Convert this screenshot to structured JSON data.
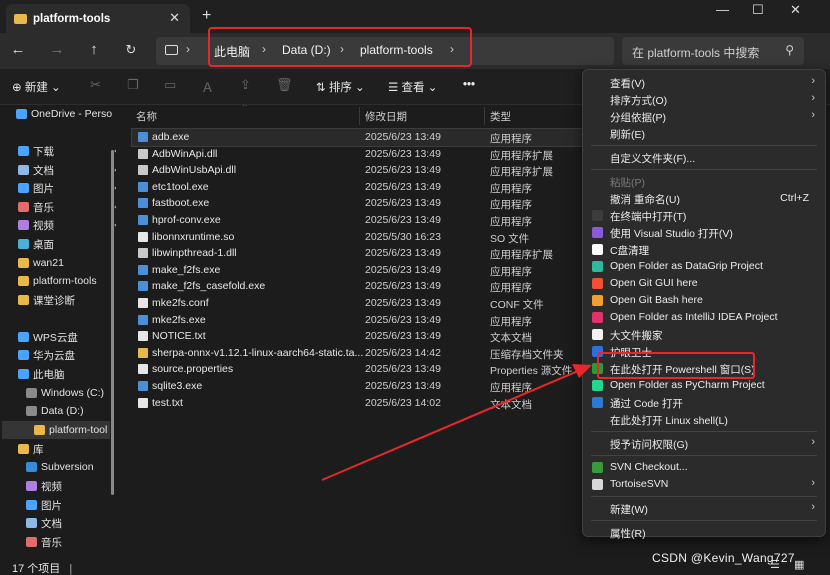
{
  "window": {
    "tab_title": "platform-tools",
    "new_tab_symbol": "+",
    "minimize_symbol": "—",
    "maximize_symbol": "☐",
    "close_symbol": "✕"
  },
  "nav": {
    "back": "←",
    "forward": "→",
    "up": "↑",
    "refresh": "↻"
  },
  "address": {
    "crumbs": [
      "此电脑",
      "Data (D:)",
      "platform-tools"
    ],
    "separator": "›"
  },
  "search": {
    "placeholder": "在 platform-tools 中搜索"
  },
  "toolbar": {
    "new_label": "新建",
    "sort_label": "排序",
    "view_label": "查看",
    "more_label": "•••"
  },
  "sidebar": {
    "items": [
      {
        "label": "OneDrive - Perso",
        "icon": "cloud-icon"
      },
      {
        "label": "下载",
        "icon": "download-icon"
      },
      {
        "label": "文档",
        "icon": "document-icon"
      },
      {
        "label": "图片",
        "icon": "pictures-icon"
      },
      {
        "label": "音乐",
        "icon": "music-icon"
      },
      {
        "label": "视频",
        "icon": "video-icon"
      },
      {
        "label": "桌面",
        "icon": "desktop-icon"
      },
      {
        "label": "wan21",
        "icon": "folder-icon"
      },
      {
        "label": "platform-tools",
        "icon": "folder-icon"
      },
      {
        "label": "课堂诊断",
        "icon": "folder-icon"
      },
      {
        "label": "WPS云盘",
        "icon": "cloud-icon"
      },
      {
        "label": "华为云盘",
        "icon": "cloud-icon"
      },
      {
        "label": "此电脑",
        "icon": "pc-icon"
      },
      {
        "label": "Windows (C:)",
        "icon": "drive-icon"
      },
      {
        "label": "Data (D:)",
        "icon": "drive-icon"
      },
      {
        "label": "platform-tool",
        "icon": "folder-icon"
      },
      {
        "label": "库",
        "icon": "library-icon"
      },
      {
        "label": "Subversion",
        "icon": "subversion-icon"
      },
      {
        "label": "视频",
        "icon": "video-icon"
      },
      {
        "label": "图片",
        "icon": "pictures-icon"
      },
      {
        "label": "文档",
        "icon": "document-icon"
      },
      {
        "label": "音乐",
        "icon": "music-icon"
      }
    ],
    "pin_symbol": "📌"
  },
  "columns": {
    "name": "名称",
    "date": "修改日期",
    "type": "类型"
  },
  "files": [
    {
      "name": "adb.exe",
      "date": "2025/6/23 13:49",
      "type": "应用程序",
      "icon": "exe"
    },
    {
      "name": "AdbWinApi.dll",
      "date": "2025/6/23 13:49",
      "type": "应用程序扩展",
      "icon": "dll"
    },
    {
      "name": "AdbWinUsbApi.dll",
      "date": "2025/6/23 13:49",
      "type": "应用程序扩展",
      "icon": "dll"
    },
    {
      "name": "etc1tool.exe",
      "date": "2025/6/23 13:49",
      "type": "应用程序",
      "icon": "exe"
    },
    {
      "name": "fastboot.exe",
      "date": "2025/6/23 13:49",
      "type": "应用程序",
      "icon": "exe"
    },
    {
      "name": "hprof-conv.exe",
      "date": "2025/6/23 13:49",
      "type": "应用程序",
      "icon": "exe"
    },
    {
      "name": "libonnxruntime.so",
      "date": "2025/5/30 16:23",
      "type": "SO 文件",
      "icon": "file"
    },
    {
      "name": "libwinpthread-1.dll",
      "date": "2025/6/23 13:49",
      "type": "应用程序扩展",
      "icon": "dll"
    },
    {
      "name": "make_f2fs.exe",
      "date": "2025/6/23 13:49",
      "type": "应用程序",
      "icon": "exe"
    },
    {
      "name": "make_f2fs_casefold.exe",
      "date": "2025/6/23 13:49",
      "type": "应用程序",
      "icon": "exe"
    },
    {
      "name": "mke2fs.conf",
      "date": "2025/6/23 13:49",
      "type": "CONF 文件",
      "icon": "file"
    },
    {
      "name": "mke2fs.exe",
      "date": "2025/6/23 13:49",
      "type": "应用程序",
      "icon": "exe"
    },
    {
      "name": "NOTICE.txt",
      "date": "2025/6/23 13:49",
      "type": "文本文档",
      "icon": "file"
    },
    {
      "name": "sherpa-onnx-v1.12.1-linux-aarch64-static.ta...",
      "date": "2025/6/23 14:42",
      "type": "压缩存档文件夹",
      "icon": "zip"
    },
    {
      "name": "source.properties",
      "date": "2025/6/23 13:49",
      "type": "Properties 源文件",
      "icon": "file"
    },
    {
      "name": "sqlite3.exe",
      "date": "2025/6/23 13:49",
      "type": "应用程序",
      "icon": "exe"
    },
    {
      "name": "test.txt",
      "date": "2025/6/23 14:02",
      "type": "文本文档",
      "icon": "file"
    }
  ],
  "status": {
    "item_count": "17 个项目"
  },
  "watermark": "CSDN @Kevin_Wang727",
  "context_menu": {
    "items": [
      {
        "label": "查看(V)",
        "arrow": "›",
        "icon": "none"
      },
      {
        "label": "排序方式(O)",
        "arrow": "›",
        "icon": "none"
      },
      {
        "label": "分组依据(P)",
        "arrow": "›",
        "icon": "none"
      },
      {
        "label": "刷新(E)",
        "icon": "none"
      },
      {
        "sep": true
      },
      {
        "label": "自定义文件夹(F)...",
        "icon": "none"
      },
      {
        "sep": true
      },
      {
        "label": "粘贴(P)",
        "dim": true,
        "icon": "none"
      },
      {
        "label": "撤消 重命名(U)",
        "shortcut": "Ctrl+Z",
        "icon": "none"
      },
      {
        "label": "在终端中打开(T)",
        "icon": "terminal-icon"
      },
      {
        "label": "使用 Visual Studio 打开(V)",
        "icon": "visual-studio-icon"
      },
      {
        "label": "C盘清理",
        "icon": "cleanup-icon"
      },
      {
        "label": "Open Folder as DataGrip Project",
        "icon": "datagrip-icon"
      },
      {
        "label": "Open Git GUI here",
        "icon": "git-gui-icon"
      },
      {
        "label": "Open Git Bash here",
        "icon": "git-bash-icon"
      },
      {
        "label": "Open Folder as IntelliJ IDEA Project",
        "icon": "intellij-icon"
      },
      {
        "label": "大文件搬家",
        "icon": "move-files-icon"
      },
      {
        "label": "护眼卫士",
        "icon": "shield-icon"
      },
      {
        "label": "在此处打开 Powershell 窗口(S)",
        "icon": "powershell-icon"
      },
      {
        "label": "Open Folder as PyCharm Project",
        "icon": "pycharm-icon"
      },
      {
        "label": "通过 Code 打开",
        "icon": "vscode-icon"
      },
      {
        "label": "在此处打开 Linux shell(L)",
        "icon": "none"
      },
      {
        "sep": true
      },
      {
        "label": "授予访问权限(G)",
        "arrow": "›",
        "icon": "none"
      },
      {
        "sep": true
      },
      {
        "label": "SVN Checkout...",
        "icon": "svn-checkout-icon"
      },
      {
        "label": "TortoiseSVN",
        "arrow": "›",
        "icon": "tortoisesvn-icon"
      },
      {
        "sep": true
      },
      {
        "label": "新建(W)",
        "arrow": "›",
        "icon": "none"
      },
      {
        "sep": true
      },
      {
        "label": "属性(R)",
        "icon": "none"
      }
    ]
  },
  "colors": {
    "highlight_red": "#e8272a",
    "folder_yellow": "#e8b84a",
    "accent_blue": "#4aa3ff"
  }
}
